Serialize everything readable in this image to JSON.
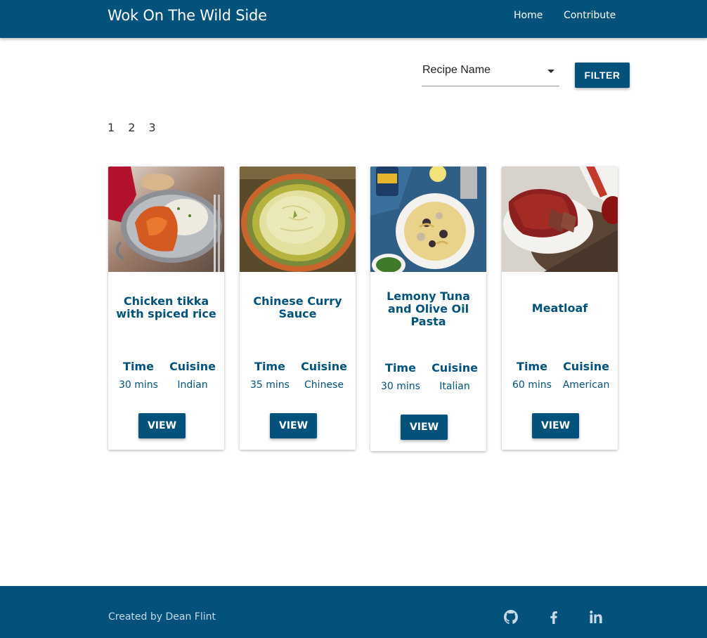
{
  "nav": {
    "brand": "Wok On The Wild Side",
    "links": [
      {
        "label": "Home"
      },
      {
        "label": "Contribute"
      }
    ]
  },
  "filter": {
    "select_value": "Recipe Name",
    "button_label": "FILTER"
  },
  "pagination": [
    "1",
    "2",
    "3"
  ],
  "recipes": [
    {
      "title": "Chicken tikka with spiced rice",
      "time_label": "Time",
      "time": "30 mins",
      "cuisine_label": "Cuisine",
      "cuisine": "Indian",
      "button": "VIEW",
      "image": "chicken-tikka-photo"
    },
    {
      "title": "Chinese Curry Sauce",
      "time_label": "Time",
      "time": "35 mins",
      "cuisine_label": "Cuisine",
      "cuisine": "Chinese",
      "button": "VIEW",
      "image": "curry-sauce-photo"
    },
    {
      "title": "Lemony Tuna and Olive Oil Pasta",
      "time_label": "Time",
      "time": "30 mins",
      "cuisine_label": "Cuisine",
      "cuisine": "Italian",
      "button": "VIEW",
      "image": "tuna-pasta-photo"
    },
    {
      "title": "Meatloaf",
      "time_label": "Time",
      "time": "60 mins",
      "cuisine_label": "Cuisine",
      "cuisine": "American",
      "button": "VIEW",
      "image": "meatloaf-photo"
    }
  ],
  "footer": {
    "credit": "Created by Dean Flint",
    "icons": [
      "github-icon",
      "facebook-icon",
      "linkedin-icon"
    ]
  },
  "colors": {
    "brand": "#02527c",
    "footer_text": "#c9d9e6"
  }
}
